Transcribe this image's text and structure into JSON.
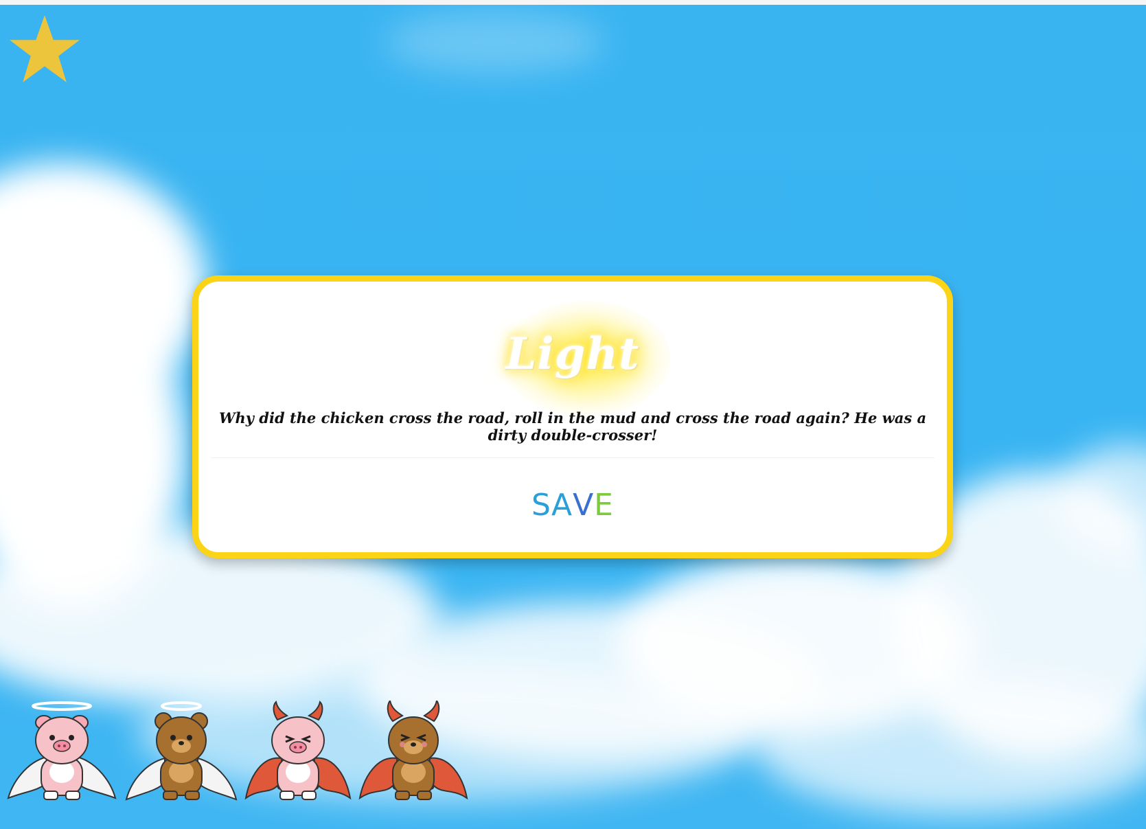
{
  "game": {
    "card": {
      "title": "Light",
      "joke": "Why did the chicken cross the road, roll in the mud and cross the road again? He was a dirty double-crosser!",
      "save_letters": [
        {
          "ch": "S",
          "color": "#2a9fd8"
        },
        {
          "ch": "A",
          "color": "#2a9fd8"
        },
        {
          "ch": "V",
          "color": "#3a6fd0"
        },
        {
          "ch": "E",
          "color": "#7bcb3a"
        }
      ]
    },
    "star_icon": "star-icon",
    "characters": [
      {
        "name": "angel-pig",
        "icon": "angel-pig-icon"
      },
      {
        "name": "angel-bear",
        "icon": "angel-bear-icon"
      },
      {
        "name": "devil-pig",
        "icon": "devil-pig-icon"
      },
      {
        "name": "devil-bear",
        "icon": "devil-bear-icon"
      }
    ],
    "colors": {
      "sky": "#38b4f2",
      "card_border": "#fbd417",
      "star": "#edc53d"
    }
  }
}
